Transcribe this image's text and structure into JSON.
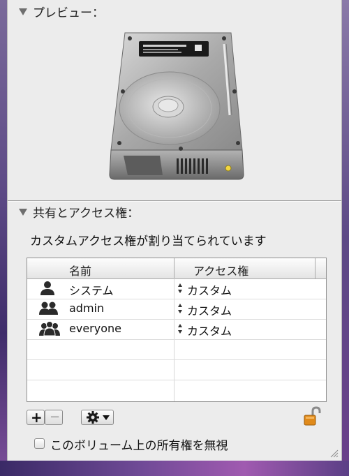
{
  "preview": {
    "title": "プレビュー："
  },
  "sharing": {
    "title": "共有とアクセス権：",
    "subtitle": "カスタムアクセス権が割り当てられています",
    "columns": {
      "name": "名前",
      "access": "アクセス権"
    },
    "rows": [
      {
        "name": "システム",
        "access": "カスタム",
        "icon": "single-user-icon"
      },
      {
        "name": "admin",
        "access": "カスタム",
        "icon": "group-user-icon"
      },
      {
        "name": "everyone",
        "access": "カスタム",
        "icon": "everyone-user-icon"
      }
    ]
  },
  "toolbar": {
    "add_label": "+",
    "remove_label": "−",
    "action_icon": "gear-icon",
    "lock_icon": "unlocked-padlock-icon"
  },
  "ignore_ownership": {
    "label": "このボリューム上の所有権を無視",
    "checked": false
  },
  "colors": {
    "panel_bg": "#ececec",
    "lock": "#e08a1a"
  }
}
